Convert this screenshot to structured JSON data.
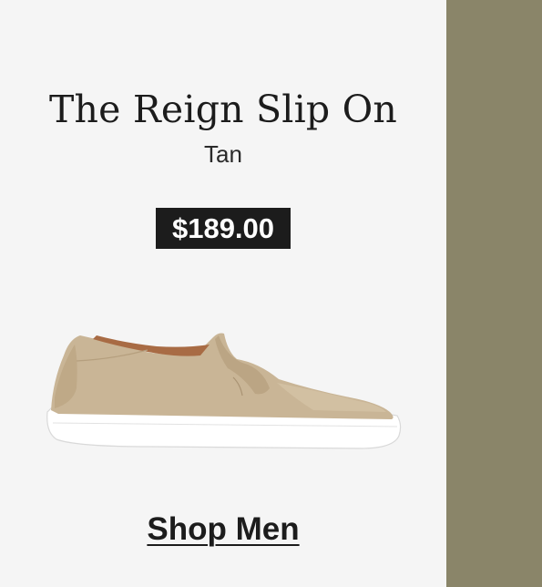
{
  "product": {
    "name": "The Reign Slip On",
    "color": "Tan",
    "price": "$189.00",
    "image_icon": "slip-on-sneaker-image"
  },
  "cta": {
    "label": "Shop Men"
  },
  "colors": {
    "side_panel": "#8a8569",
    "background": "#f5f5f5",
    "text": "#1c1c1c",
    "price_badge_bg": "#1c1c1c",
    "price_badge_text": "#ffffff",
    "shoe_suede": "#c9b596",
    "shoe_sole": "#ffffff"
  }
}
